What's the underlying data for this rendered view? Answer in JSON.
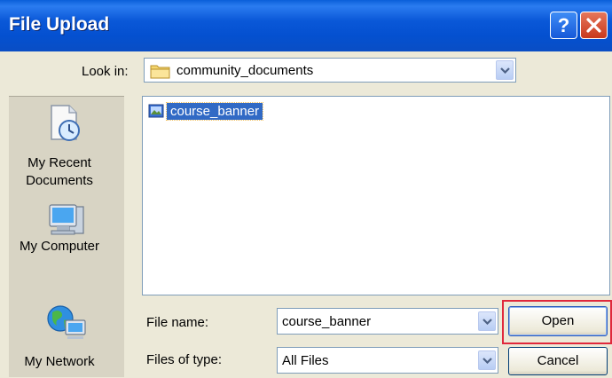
{
  "window": {
    "title": "File Upload",
    "help_icon": "help-icon",
    "close_icon": "close-icon"
  },
  "look_in": {
    "label": "Look in:",
    "value": "community_documents",
    "icon": "folder-icon"
  },
  "places": [
    {
      "label_line1": "My Recent",
      "label_line2": "Documents",
      "icon": "recent-documents-icon"
    },
    {
      "label_line1": "My Computer",
      "label_line2": "",
      "icon": "computer-icon"
    },
    {
      "label_line1": "My Network",
      "label_line2": "",
      "icon": "network-icon"
    }
  ],
  "files": [
    {
      "name": "course_banner",
      "icon": "image-file-icon",
      "selected": true
    }
  ],
  "file_name": {
    "label": "File name:",
    "value": "course_banner"
  },
  "files_of_type": {
    "label": "Files of type:",
    "value": "All Files"
  },
  "buttons": {
    "open": "Open",
    "cancel": "Cancel"
  },
  "colors": {
    "titlebar": "#0a58d8",
    "selection": "#316ac5",
    "highlight": "#e0283c"
  }
}
